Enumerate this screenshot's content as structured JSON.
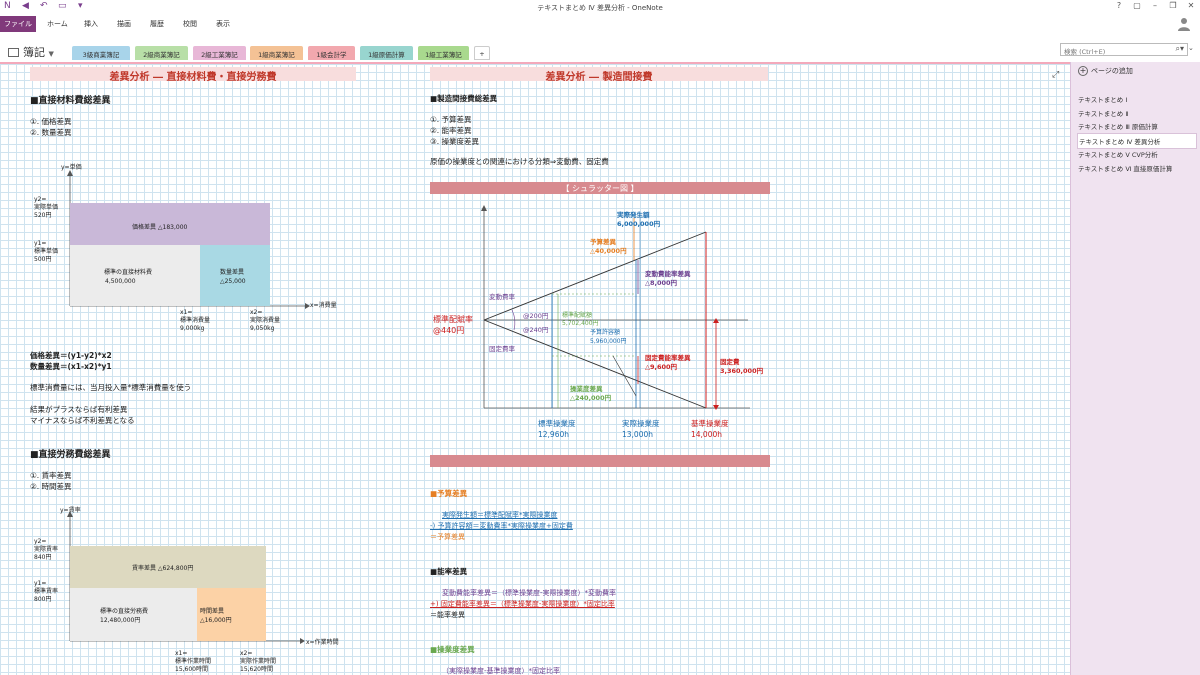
{
  "window": {
    "title": "テキストまとめ Ⅳ 差異分析 - OneNote",
    "controls": [
      "?",
      "▢",
      "–",
      "❐",
      "✕"
    ]
  },
  "ribbon": {
    "tabs": [
      "ファイル",
      "ホーム",
      "挿入",
      "描画",
      "履歴",
      "校閲",
      "表示"
    ]
  },
  "notebook": {
    "name": "簿記"
  },
  "sections": [
    {
      "label": "3級商業簿記",
      "color": "#a8d4ea"
    },
    {
      "label": "2級商業簿記",
      "color": "#b8dfa7"
    },
    {
      "label": "2級工業簿記",
      "color": "#e8b7d7"
    },
    {
      "label": "1級商業簿記",
      "color": "#f4c295"
    },
    {
      "label": "1級会計学",
      "color": "#f2a8ae"
    },
    {
      "label": "1級原価計算",
      "color": "#98d5cf"
    },
    {
      "label": "1級工業簿記",
      "color": "#a9d98e"
    },
    {
      "label": "+",
      "color": "#ffffff"
    }
  ],
  "search": {
    "placeholder": "検索 (Ctrl+E)"
  },
  "pages": {
    "add_label": "ページの追加",
    "items": [
      "テキストまとめ Ⅰ",
      "テキストまとめ Ⅱ",
      "テキストまとめ Ⅲ 原価計算",
      "テキストまとめ Ⅳ 差異分析",
      "テキストまとめ Ⅴ CVP分析",
      "テキストまとめ Ⅵ 直接原価計算"
    ],
    "selected_index": 3
  },
  "left": {
    "header": "差異分析 ― 直接材料費・直接労務費",
    "material": {
      "title": "■直接材料費総差異",
      "items": [
        "①. 価格差異",
        "②. 数量差異"
      ],
      "y_axis": "y=単価",
      "y2": [
        "y2=",
        "実際単価",
        "520円"
      ],
      "y1": [
        "y1=",
        "標準単価",
        "500円"
      ],
      "box_price": "価格差異 △183,000",
      "box_std": [
        "標準の直接材料費",
        "4,500,000"
      ],
      "box_qty": [
        "数量差異",
        "△25,000"
      ],
      "x_axis": "x=消費量",
      "x1": [
        "x1=",
        "標準消費量",
        "9,000kg"
      ],
      "x2": [
        "x2=",
        "実際消費量",
        "9,050kg"
      ]
    },
    "formulas": [
      "価格差異＝(y1-y2)*x2",
      "数量差異＝(x1-x2)*y1"
    ],
    "note1": "標準消費量には、当月投入量*標準消費量を使う",
    "note2": [
      "結果がプラスならば有利差異",
      "マイナスならば不利差異となる"
    ],
    "labor": {
      "title": "■直接労務費総差異",
      "items": [
        "①. 賃率差異",
        "②. 時間差異"
      ],
      "y_axis": "y=賃率",
      "y2": [
        "y2=",
        "実際賃率",
        "840円"
      ],
      "y1": [
        "y1=",
        "標準賃率",
        "800円"
      ],
      "box_rate": "賃率差異 △624,800円",
      "box_std": [
        "標準の直接労務費",
        "12,480,000円"
      ],
      "box_time": [
        "時間差異",
        "△16,000円"
      ],
      "x_axis": "x=作業時間",
      "x1": [
        "x1=",
        "標準作業時間",
        "15,600時間"
      ],
      "x2": [
        "x2=",
        "実際作業時間",
        "15,620時間"
      ]
    }
  },
  "right": {
    "header": "差異分析 ― 製造間接費",
    "title": "■製造間接費総差異",
    "items": [
      "①. 予算差異",
      "②. 能率差異",
      "③. 操業度差異"
    ],
    "note": "原価の操業度との関連における分類⇒変動費、固定費",
    "shuratter": "【 シュラッター図 】",
    "diagram": {
      "actual_cost": [
        "実際発生額",
        "6,000,000円"
      ],
      "budget_var": [
        "予算差異",
        "△40,000円"
      ],
      "var_eff": [
        "変動費能率差異",
        "△8,000円"
      ],
      "var_rate": "変動費率",
      "std_rate": [
        "標準配賦率",
        "@440円"
      ],
      "v200": "@200円",
      "v240": "@240円",
      "std_alloc": [
        "標準配賦額",
        "5,702,400円"
      ],
      "budget_allow": [
        "予算許容額",
        "5,960,000円"
      ],
      "fixed_rate": "固定費率",
      "fix_eff": [
        "固定費能率差異",
        "△9,600円"
      ],
      "vol_var": [
        "操業度差異",
        "△240,000円"
      ],
      "fixed_cost": [
        "固定費",
        "3,360,000円"
      ],
      "std_op": [
        "標準操業度",
        "12,960h"
      ],
      "act_op": [
        "実際操業度",
        "13,000h"
      ],
      "base_op": [
        "基準操業度",
        "14,000h"
      ]
    },
    "budget": {
      "title": "■予算差異",
      "l1": "実際発生額＝標準配賦率*実際操業度",
      "l2": "-) 予算許容額＝変動費率*実際操業度+固定費",
      "l3": "＝予算差異"
    },
    "efficiency": {
      "title": "■能率差異",
      "l1": "変動費能率差異＝（標準操業度-実際操業度）*変動費率",
      "l2": "+) 固定費能率差異＝（標準操業度-実際操業度）*固定比率",
      "l3": "＝能率差異"
    },
    "volume": {
      "title": "■操業度差異",
      "l1": "（実際操業度-基準操業度）*固定比率"
    }
  },
  "colors": {
    "accent": "#80397b",
    "header_red": "#c0392b",
    "bar": "#d88a8f",
    "box_purple": "#c9b8d8",
    "box_teal": "#a9d9e4",
    "box_tan": "#ddd9c0",
    "box_orange": "#fcd2a6",
    "orange": "#e67e22",
    "blue": "#1f6fb0",
    "purple": "#6b3e8e",
    "green": "#6aa84f",
    "red": "#cc1f1f"
  }
}
